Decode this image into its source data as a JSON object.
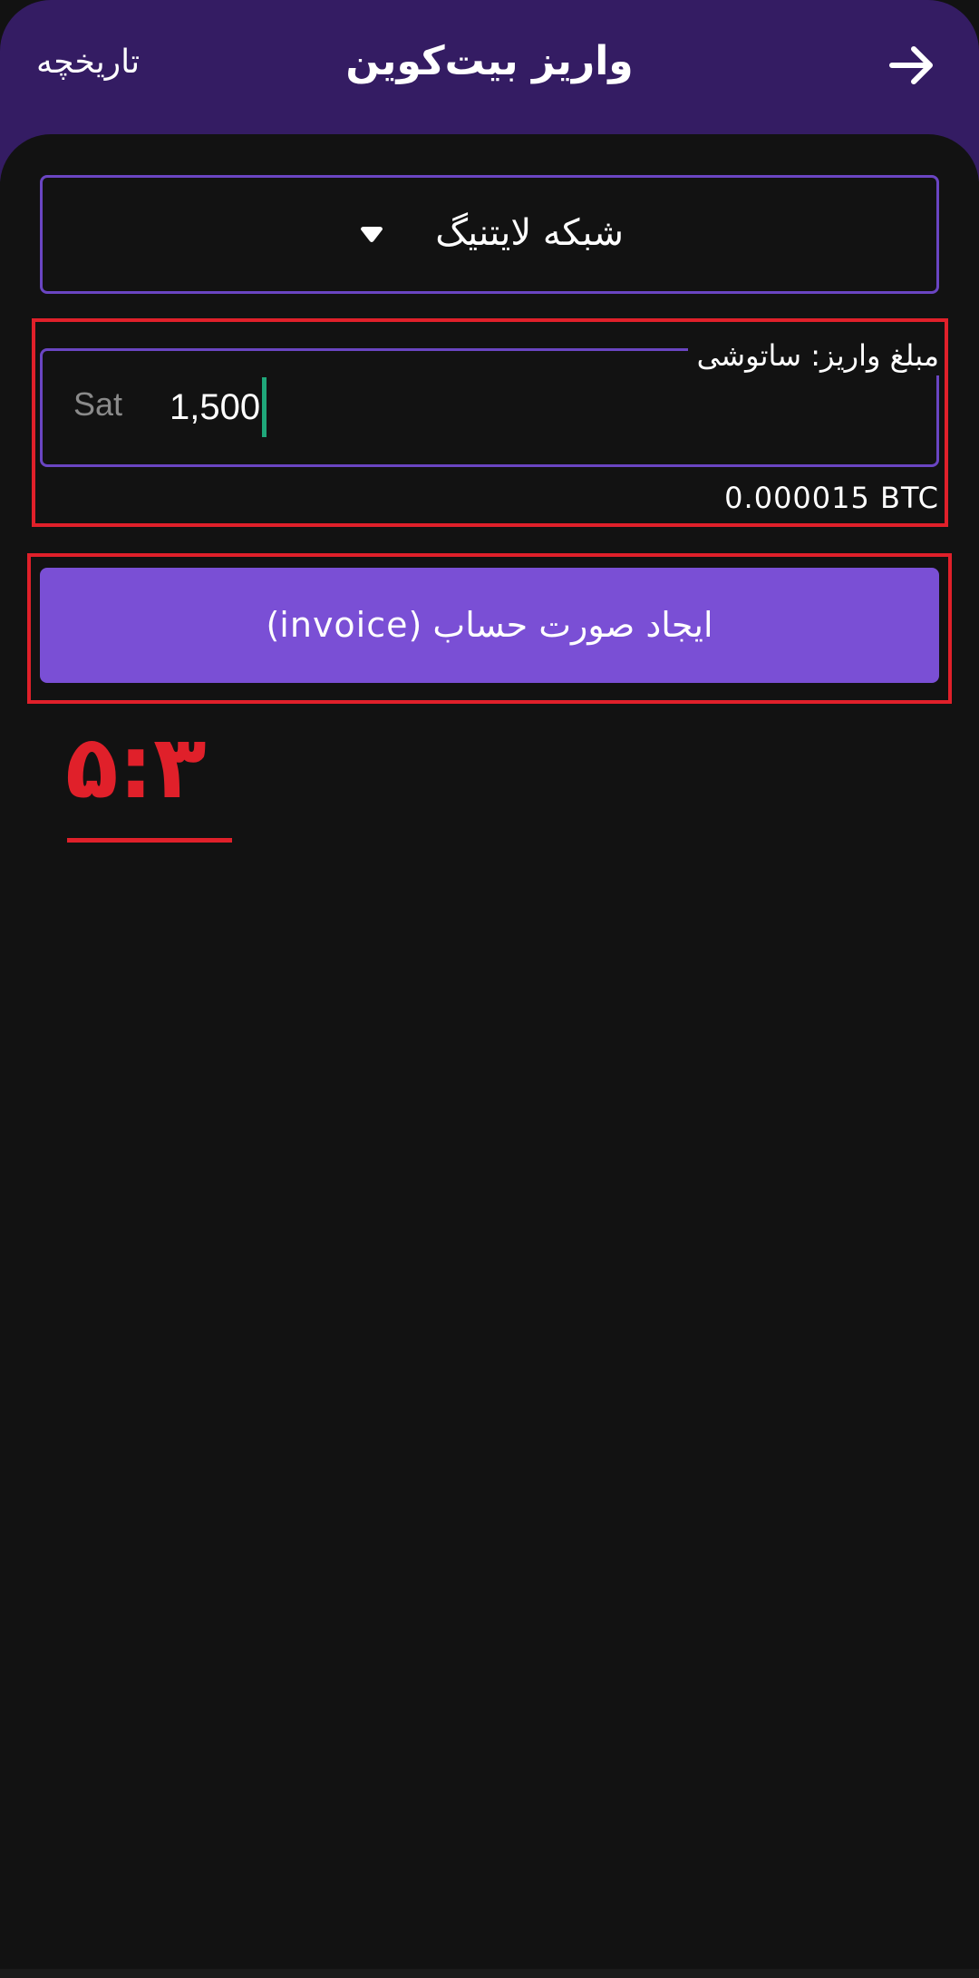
{
  "header": {
    "title": "واریز بیت‌کوین",
    "history_label": "تاریخچه",
    "back_icon": "arrow-right-icon"
  },
  "network": {
    "selected": "شبکه لایتنیگ",
    "dropdown_icon": "caret-down-icon"
  },
  "amount": {
    "label": "مبلغ واریز: ساتوشی",
    "unit": "Sat",
    "value": "1,500",
    "btc_equivalent": "0.000015 BTC"
  },
  "invoice": {
    "button_label": "ایجاد صورت حساب (invoice)"
  },
  "annotation": {
    "time": "۵:۳"
  },
  "colors": {
    "header_bg": "#341c63",
    "accent": "#7a4fd5",
    "outline": "#6a45c2",
    "highlight": "#e0202a",
    "caret": "#1fa77a",
    "background": "#121212"
  }
}
